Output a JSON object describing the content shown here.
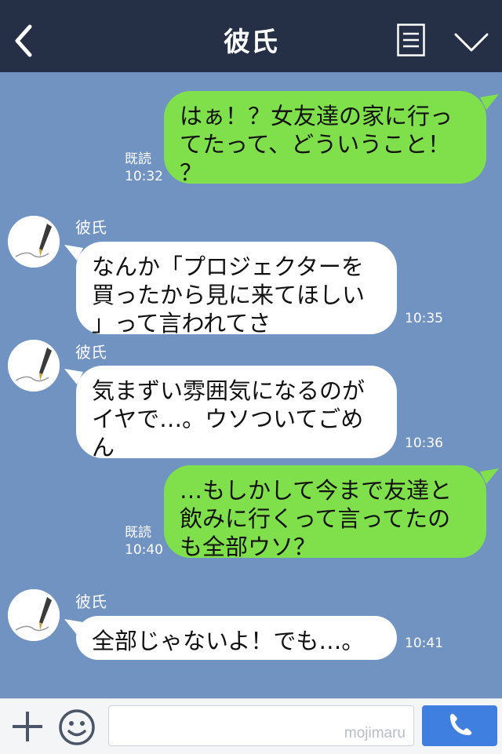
{
  "header": {
    "title": "彼氏",
    "back_icon": "chevron-left-icon",
    "menu_icon": "list-icon",
    "collapse_icon": "chevron-down-icon"
  },
  "messages": [
    {
      "direction": "out",
      "text": "はぁ！？女友達の家に行っ\nてたって、どういうこと！\n？",
      "read": "既読",
      "time": "10:32"
    },
    {
      "direction": "in",
      "sender": "彼氏",
      "text": "なんか「プロジェクターを\n買ったから見に来てほしい\n」って言われてさ",
      "time": "10:35"
    },
    {
      "direction": "in",
      "sender": "彼氏",
      "text": "気まずい雰囲気になるのが\nイヤで…。ウソついてごめ\nん",
      "time": "10:36"
    },
    {
      "direction": "out",
      "text": "…もしかして今まで友達と\n飲みに行くって言ってたの\nも全部ウソ？",
      "read": "既読",
      "time": "10:40"
    },
    {
      "direction": "in",
      "sender": "彼氏",
      "text": "全部じゃないよ！でも…。",
      "time": "10:41"
    }
  ],
  "footer": {
    "plus_icon": "plus-icon",
    "emoji_icon": "smiley-icon",
    "call_icon": "phone-icon",
    "watermark": "mojimaru"
  },
  "colors": {
    "header_bg": "#253047",
    "chat_bg": "#7193c2",
    "outgoing_bubble": "#7fe04b",
    "incoming_bubble": "#ffffff",
    "call_button": "#3f7fe0"
  }
}
